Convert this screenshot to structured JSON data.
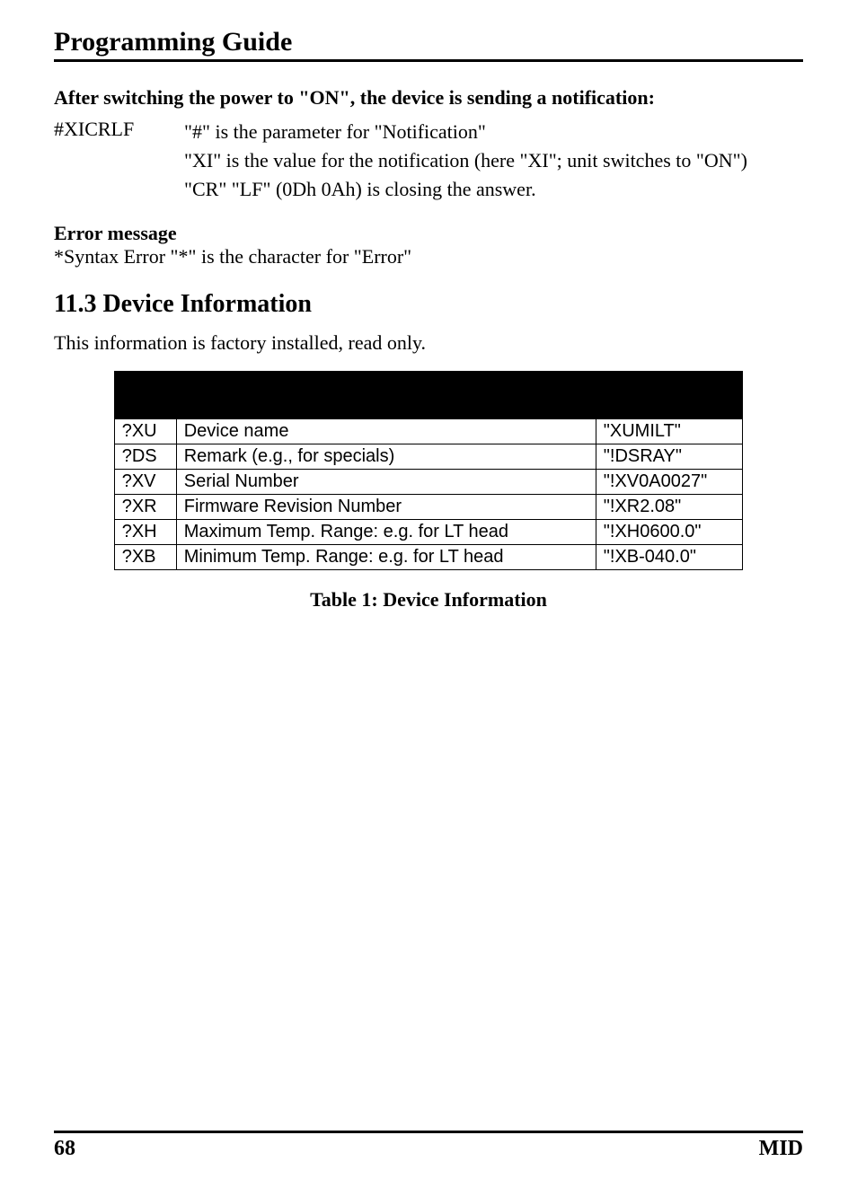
{
  "header": {
    "title": "Programming Guide"
  },
  "intro": "After switching the power to \"ON\", the device is sending a notification:",
  "notification": {
    "label": "#XICRLF",
    "line1": "\"#\" is the parameter for \"Notification\"",
    "line2": "\"XI\" is the value for the notification (here \"XI\"; unit switches to \"ON\")",
    "line3": "\"CR\" \"LF\" (0Dh 0Ah) is closing the answer."
  },
  "error": {
    "heading": "Error message",
    "text": "*Syntax Error \"*\" is the character for \"Error\""
  },
  "section": {
    "heading": "11.3 Device Information",
    "intro": "This information is factory installed, read only.",
    "caption": "Table 1: Device Information"
  },
  "table": {
    "headers": [
      "",
      "",
      ""
    ],
    "rows": [
      {
        "cmd": "?XU",
        "desc": "Device name",
        "resp": "\"XUMILT\""
      },
      {
        "cmd": "?DS",
        "desc": "Remark (e.g., for specials)",
        "resp": "\"!DSRAY\""
      },
      {
        "cmd": "?XV",
        "desc": "Serial Number",
        "resp": "\"!XV0A0027\""
      },
      {
        "cmd": "?XR",
        "desc": "Firmware Revision Number",
        "resp": "\"!XR2.08\""
      },
      {
        "cmd": "?XH",
        "desc": "Maximum Temp. Range: e.g. for LT head",
        "resp": "\"!XH0600.0\""
      },
      {
        "cmd": "?XB",
        "desc": "Minimum Temp. Range: e.g. for LT head",
        "resp": "\"!XB-040.0\""
      }
    ]
  },
  "footer": {
    "page": "68",
    "brand": "MID"
  }
}
